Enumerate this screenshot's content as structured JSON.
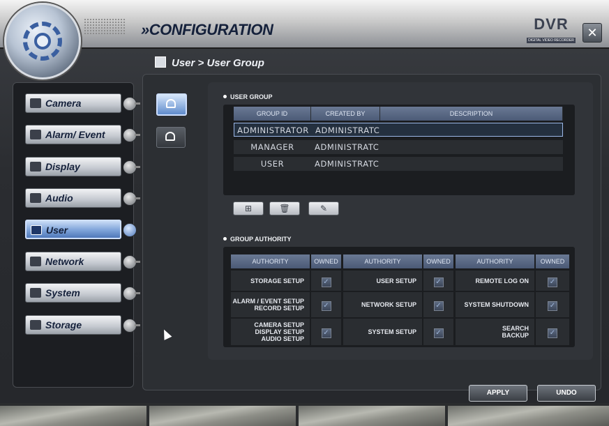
{
  "header": {
    "title": "»CONFIGURATION",
    "logo_text": "DVR",
    "logo_subtext": "DIGITAL VIDEO RECORDER",
    "close_label": "✕"
  },
  "breadcrumb": "User > User Group",
  "nav": {
    "items": [
      {
        "label": "Camera",
        "icon": "camera-icon",
        "active": false
      },
      {
        "label": "Alarm/ Event",
        "icon": "alarm-icon",
        "active": false
      },
      {
        "label": "Display",
        "icon": "display-icon",
        "active": false
      },
      {
        "label": "Audio",
        "icon": "speaker-icon",
        "active": false
      },
      {
        "label": "User",
        "icon": "user-icon",
        "active": true
      },
      {
        "label": "Network",
        "icon": "network-icon",
        "active": false
      },
      {
        "label": "System",
        "icon": "wrench-icon",
        "active": false
      },
      {
        "label": "Storage",
        "icon": "harddisk-icon",
        "active": false
      }
    ]
  },
  "side_tabs": [
    {
      "name": "user-group",
      "icon": "user-group-icon",
      "active": true
    },
    {
      "name": "user-list",
      "icon": "user-list-icon",
      "active": false
    }
  ],
  "user_group": {
    "section_title": "USER GROUP",
    "columns": [
      "GROUP ID",
      "CREATED BY",
      "DESCRIPTION"
    ],
    "rows": [
      {
        "group_id": "ADMINISTRATOR",
        "created_by": "ADMINISTRATC",
        "description": "",
        "selected": true
      },
      {
        "group_id": "MANAGER",
        "created_by": "ADMINISTRATC",
        "description": "",
        "selected": false
      },
      {
        "group_id": "USER",
        "created_by": "ADMINISTRATC",
        "description": "",
        "selected": false
      }
    ],
    "tools": [
      {
        "name": "add",
        "icon": "add-icon",
        "glyph": "⊞"
      },
      {
        "name": "delete",
        "icon": "trash-icon",
        "glyph": "🗑"
      },
      {
        "name": "edit",
        "icon": "edit-icon",
        "glyph": "✎"
      }
    ]
  },
  "group_authority": {
    "section_title": "GROUP AUTHORITY",
    "col_authority": "AUTHORITY",
    "col_owned": "OWNED",
    "rows": [
      [
        "STORAGE SETUP",
        "USER SETUP",
        "REMOTE LOG ON"
      ],
      [
        "ALARM / EVENT SETUP\nRECORD SETUP",
        "NETWORK SETUP",
        "SYSTEM SHUTDOWN"
      ],
      [
        "CAMERA SETUP\nDISPLAY SETUP\nAUDIO SETUP",
        "SYSTEM SETUP",
        "SEARCH\nBACKUP"
      ]
    ],
    "owned": [
      [
        true,
        true,
        true
      ],
      [
        true,
        true,
        true
      ],
      [
        true,
        true,
        true
      ]
    ]
  },
  "footer": {
    "apply_label": "APPLY",
    "undo_label": "UNDO"
  },
  "colors": {
    "accent": "#4f78b9",
    "header_cell": "#5a6986",
    "panel": "#2c2f33"
  }
}
